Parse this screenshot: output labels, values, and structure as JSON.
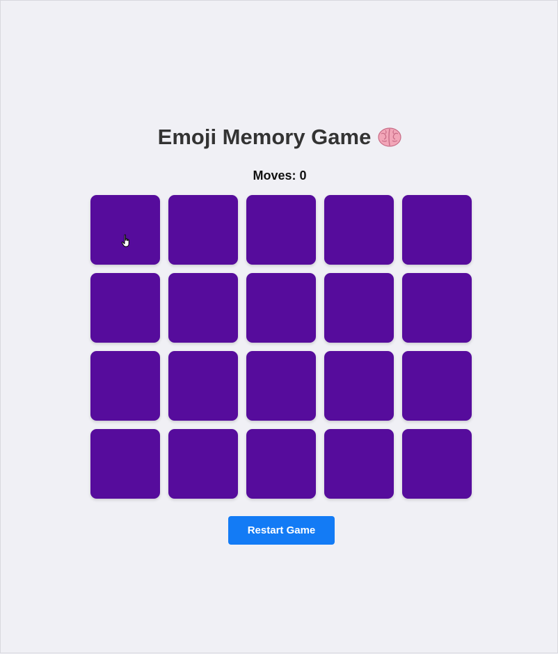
{
  "game": {
    "title": "Emoji Memory Game",
    "title_icon": "brain-icon",
    "moves_label": "Moves:",
    "moves_count": "0",
    "cards": [
      {
        "state": "face-down"
      },
      {
        "state": "face-down"
      },
      {
        "state": "face-down"
      },
      {
        "state": "face-down"
      },
      {
        "state": "face-down"
      },
      {
        "state": "face-down"
      },
      {
        "state": "face-down"
      },
      {
        "state": "face-down"
      },
      {
        "state": "face-down"
      },
      {
        "state": "face-down"
      },
      {
        "state": "face-down"
      },
      {
        "state": "face-down"
      },
      {
        "state": "face-down"
      },
      {
        "state": "face-down"
      },
      {
        "state": "face-down"
      },
      {
        "state": "face-down"
      },
      {
        "state": "face-down"
      },
      {
        "state": "face-down"
      },
      {
        "state": "face-down"
      },
      {
        "state": "face-down"
      }
    ],
    "restart_label": "Restart Game"
  },
  "colors": {
    "background": "#f0f0f5",
    "card_back": "#560c9c",
    "button": "#137bf5",
    "title_text": "#333333"
  }
}
